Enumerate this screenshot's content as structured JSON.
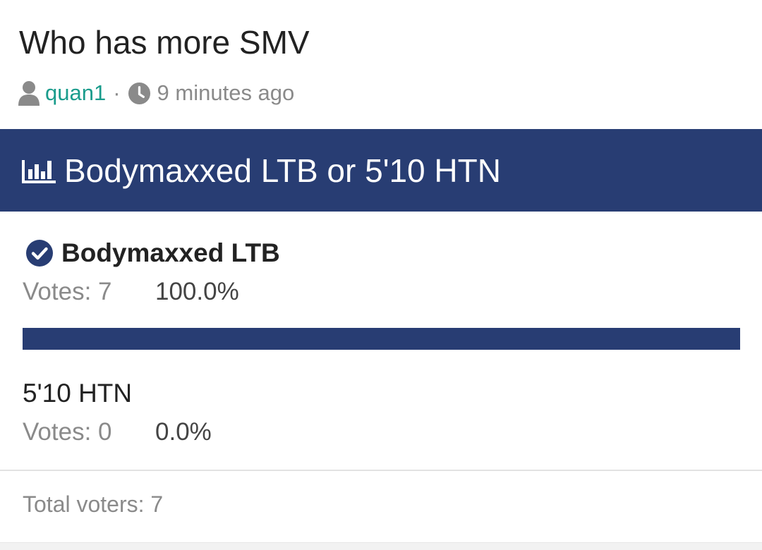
{
  "thread": {
    "title": "Who has more SMV",
    "author": "quan1",
    "separator": "·",
    "time_ago": "9 minutes ago"
  },
  "poll": {
    "question": "Bodymaxxed LTB or 5'10 HTN",
    "options": [
      {
        "label": "Bodymaxxed LTB",
        "votes_label": "Votes:",
        "votes": "7",
        "percent": "100.0%",
        "fraction": 1.0,
        "selected": true
      },
      {
        "label": "5'10 HTN",
        "votes_label": "Votes:",
        "votes": "0",
        "percent": "0.0%",
        "fraction": 0.0,
        "selected": false
      }
    ],
    "total_voters_label": "Total voters:",
    "total_voters": "7"
  },
  "colors": {
    "accent": "#283d73",
    "link": "#1a9c8c",
    "muted": "#8a8a8a"
  },
  "icons": {
    "author": "user-icon",
    "time": "clock-icon",
    "poll": "bar-chart-icon",
    "selected": "check-circle-icon"
  }
}
